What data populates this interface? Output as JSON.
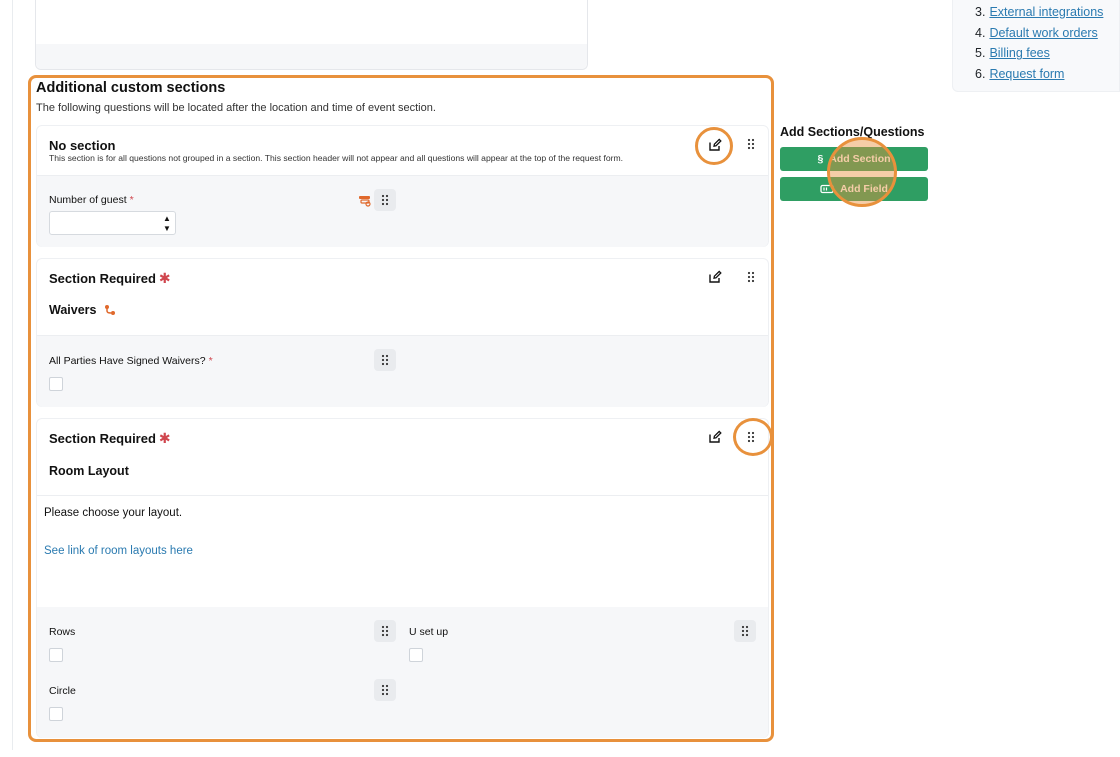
{
  "toc": {
    "items": [
      {
        "num": "3.",
        "label": "External integrations"
      },
      {
        "num": "4.",
        "label": "Default work orders"
      },
      {
        "num": "5.",
        "label": "Billing fees"
      },
      {
        "num": "6.",
        "label": "Request form"
      }
    ]
  },
  "custom_sections": {
    "title": "Additional custom sections",
    "subtitle": "The following questions will be located after the location and time of event section."
  },
  "no_section": {
    "title": "No section",
    "description": "This section is for all questions not grouped in a section. This section header will not appear and all questions will appear at the top of the request form.",
    "field_label": "Number of guest",
    "required_mark": "*",
    "input_value": "",
    "spin_up": "▲",
    "spin_down": "▼"
  },
  "waivers_section": {
    "heading": "Section Required",
    "required_star": "✱",
    "title": "Waivers",
    "field_label": "All Parties Have Signed Waivers?",
    "required_mark": "*"
  },
  "room_section": {
    "heading": "Section Required",
    "required_star": "✱",
    "title": "Room Layout",
    "instruction": "Please choose your layout.",
    "link_text": "See link of room layouts here",
    "fields": [
      {
        "label": "Rows"
      },
      {
        "label": "U set up"
      },
      {
        "label": "Circle"
      }
    ]
  },
  "add_panel": {
    "title": "Add Sections/Questions",
    "add_section_icon": "§",
    "add_section_label": "Add Section",
    "add_field_label": "Add Field"
  },
  "colors": {
    "highlight": "#e8913c",
    "green": "#2f9e63",
    "link": "#2a7ab0",
    "required": "#d0464e"
  },
  "icons": [
    "edit-icon",
    "drag-handle-icon",
    "branch-icon",
    "field-icon"
  ]
}
